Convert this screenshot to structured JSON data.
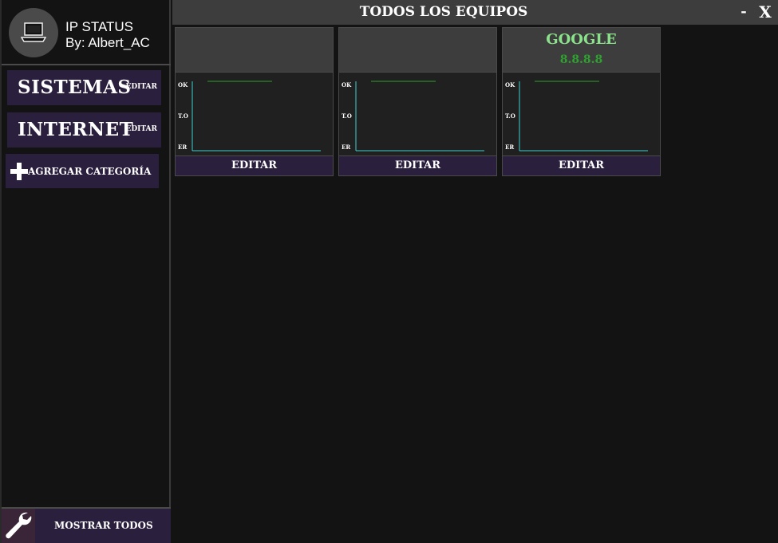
{
  "app": {
    "title": "IP STATUS",
    "author": "By: Albert_AC",
    "logo_icon": "laptop-icon"
  },
  "sidebar": {
    "categories": [
      {
        "name": "SISTEMAS",
        "edit_label": "EDITAR"
      },
      {
        "name": "INTERNET",
        "edit_label": "EDITAR"
      }
    ],
    "add_category_label": "AGREGAR CATEGORÍA",
    "add_icon": "plus-icon",
    "show_all_label": "MOSTRAR TODOS",
    "show_all_icon": "wrench-icon"
  },
  "header": {
    "title": "TODOS LOS EQUIPOS",
    "minimize_label": "-",
    "close_label": "X"
  },
  "devices": [
    {
      "name": "",
      "ip": "",
      "status_labels": [
        "OK",
        "T.O",
        "ER"
      ],
      "edit_label": "EDITAR"
    },
    {
      "name": "",
      "ip": "",
      "status_labels": [
        "OK",
        "T.O",
        "ER"
      ],
      "edit_label": "EDITAR"
    },
    {
      "name": "GOOGLE",
      "ip": "8.8.8.8",
      "status_labels": [
        "OK",
        "T.O",
        "ER"
      ],
      "edit_label": "EDITAR"
    }
  ],
  "colors": {
    "background": "#131313",
    "panel": "#3d3d3d",
    "button": "#2b1f3e",
    "name_green": "#8ae38a",
    "ip_green": "#2ea22e",
    "graph_axis": "#3fd0d0",
    "graph_line": "#2e9e2e"
  }
}
